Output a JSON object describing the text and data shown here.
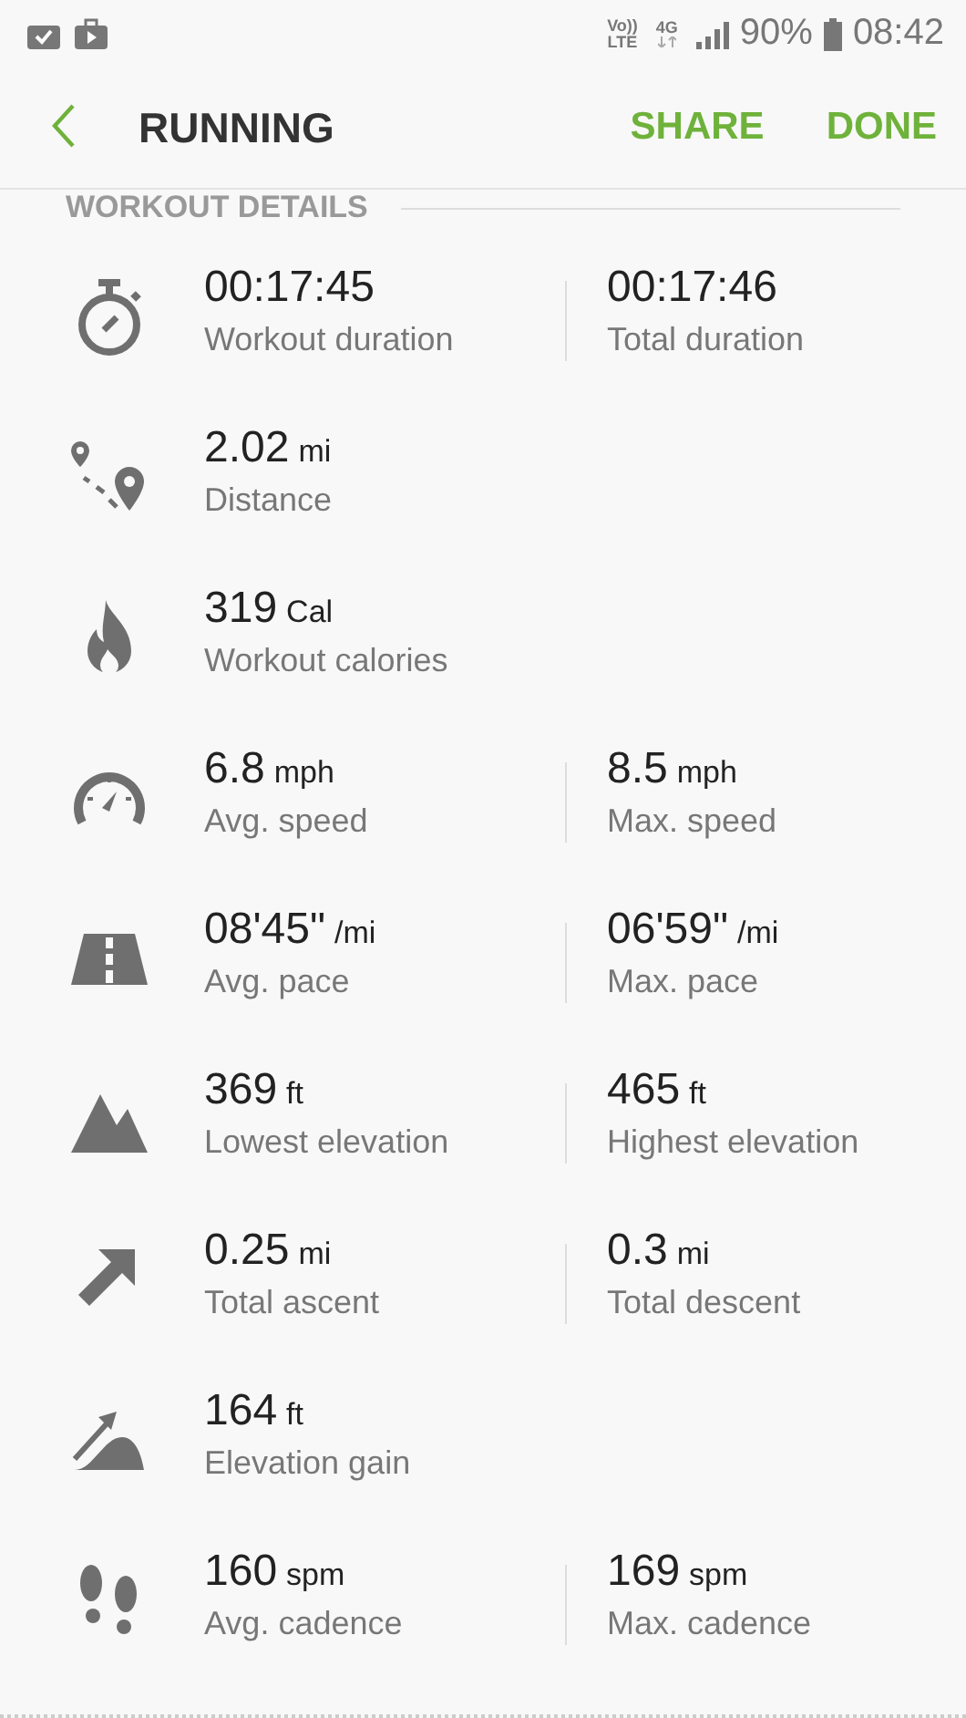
{
  "status_bar": {
    "signal_labels": [
      "Vo))",
      "LTE",
      "4G"
    ],
    "battery": "90%",
    "time": "08:42"
  },
  "header": {
    "title": "RUNNING",
    "actions": [
      "SHARE",
      "DONE"
    ]
  },
  "section": {
    "title": "WORKOUT DETAILS"
  },
  "rows": [
    {
      "kind": "stopwatch",
      "cells": [
        {
          "value": "00:17:45",
          "label": "Workout duration"
        },
        {
          "value": "00:17:46",
          "label": "Total duration"
        }
      ]
    },
    {
      "kind": "route",
      "cells": [
        {
          "value": "2.02",
          "unit": "mi",
          "label": "Distance"
        }
      ]
    },
    {
      "kind": "flame",
      "cells": [
        {
          "value": "319",
          "unit": "Cal",
          "label": "Workout calories"
        }
      ]
    },
    {
      "kind": "speedometer",
      "cells": [
        {
          "value": "6.8",
          "unit": "mph",
          "label": "Avg. speed"
        },
        {
          "value": "8.5",
          "unit": "mph",
          "label": "Max. speed"
        }
      ]
    },
    {
      "kind": "road",
      "cells": [
        {
          "value": "08'45\"",
          "unit": "/mi",
          "label": "Avg. pace"
        },
        {
          "value": "06'59\"",
          "unit": "/mi",
          "label": "Max. pace"
        }
      ]
    },
    {
      "kind": "mountain",
      "cells": [
        {
          "value": "369",
          "unit": "ft",
          "label": "Lowest elevation"
        },
        {
          "value": "465",
          "unit": "ft",
          "label": "Highest elevation"
        }
      ]
    },
    {
      "kind": "arrow",
      "cells": [
        {
          "value": "0.25",
          "unit": "mi",
          "label": "Total ascent"
        },
        {
          "value": "0.3",
          "unit": "mi",
          "label": "Total descent"
        }
      ]
    },
    {
      "kind": "gain",
      "cells": [
        {
          "value": "164",
          "unit": "ft",
          "label": "Elevation gain"
        }
      ]
    },
    {
      "kind": "footprints",
      "cells": [
        {
          "value": "160",
          "unit": "spm",
          "label": "Avg. cadence"
        },
        {
          "value": "169",
          "unit": "spm",
          "label": "Max. cadence"
        }
      ]
    }
  ]
}
